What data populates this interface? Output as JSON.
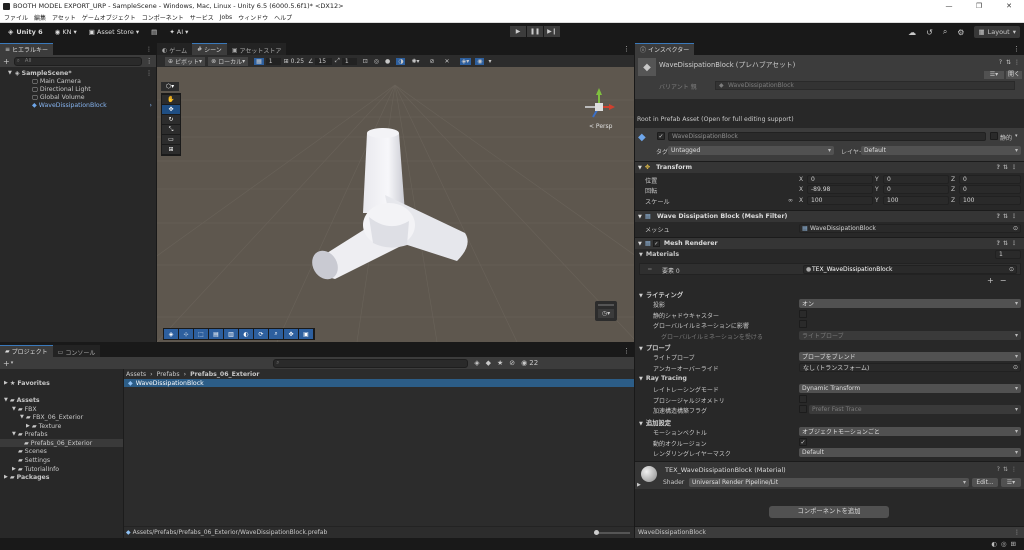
{
  "window": {
    "title": "BOOTH MODEL EXPORT_URP - SampleScene - Windows, Mac, Linux - Unity 6.5 (6000.5.6f1)* <DX12>",
    "controls": [
      "—",
      "❐",
      "✕"
    ]
  },
  "menu": [
    "ファイル",
    "編集",
    "アセット",
    "ゲームオブジェクト",
    "コンポーネント",
    "サービス",
    "Jobs",
    "ウィンドウ",
    "ヘルプ"
  ],
  "toolbar": {
    "unity": "Unity 6",
    "account": "KN",
    "asset_store": "Asset Store",
    "ai": "AI",
    "layout": "Layout"
  },
  "hierarchy": {
    "tab": "ヒエラルキー",
    "search_placeholder": "All",
    "items": [
      {
        "label": "SampleScene*",
        "indent": 0
      },
      {
        "label": "Main Camera",
        "indent": 1
      },
      {
        "label": "Directional Light",
        "indent": 1
      },
      {
        "label": "Global Volume",
        "indent": 1
      },
      {
        "label": "WaveDissipationBlock",
        "indent": 1
      }
    ]
  },
  "scene_tabs": [
    "ゲーム",
    "シーン",
    "アセットストア"
  ],
  "scene_toolbar": {
    "pivot": "ピボット",
    "local": "ローカル",
    "grid": "1",
    "snap": "0.25",
    "angle": "15",
    "scale": "1",
    "persp": "< Persp"
  },
  "project": {
    "tabs": [
      "プロジェクト",
      "コンソール"
    ],
    "count": "22",
    "breadcrumb": [
      "Assets",
      "Prefabs",
      "Prefabs_06_Exterior"
    ],
    "selected_asset": "WaveDissipationBlock",
    "tree": [
      {
        "label": "Favorites",
        "indent": 0,
        "bold": true
      },
      {
        "label": "Assets",
        "indent": 0,
        "bold": true
      },
      {
        "label": "FBX",
        "indent": 1
      },
      {
        "label": "FBX_06_Exterior",
        "indent": 2
      },
      {
        "label": "Texture",
        "indent": 3
      },
      {
        "label": "Prefabs",
        "indent": 1
      },
      {
        "label": "Prefabs_06_Exterior",
        "indent": 2
      },
      {
        "label": "Scenes",
        "indent": 1
      },
      {
        "label": "Settings",
        "indent": 1
      },
      {
        "label": "TutorialInfo",
        "indent": 1
      },
      {
        "label": "Packages",
        "indent": 0,
        "bold": true
      }
    ],
    "path": "Assets/Prefabs/Prefabs_06_Exterior/WaveDissipationBlock.prefab"
  },
  "inspector": {
    "tab": "インスペクター",
    "asset_title": "WaveDissipationBlock (プレハブアセット)",
    "open": "開く",
    "variant_label": "バリアント 親",
    "variant_value": "WaveDissipationBlock",
    "root_note": "Root in Prefab Asset (Open for full editing support)",
    "object_name": "WaveDissipationBlock",
    "static": "静的",
    "tag_label": "タグ",
    "tag": "Untagged",
    "layer_label": "レイヤー",
    "layer": "Default",
    "transform": {
      "title": "Transform",
      "position_label": "位置",
      "rotation_label": "回転",
      "scale_label": "スケール",
      "position": [
        "0",
        "0",
        "0"
      ],
      "rotation": [
        "-89.98",
        "0",
        "0"
      ],
      "scale": [
        "100",
        "100",
        "100"
      ]
    },
    "mesh_filter": {
      "title": "Wave Dissipation Block (Mesh Filter)",
      "mesh_label": "メッシュ",
      "mesh": "WaveDissipationBlock"
    },
    "mesh_renderer": {
      "title": "Mesh Renderer",
      "materials_label": "Materials",
      "materials_count": "1",
      "element_label": "要素 0",
      "element_value": "TEX_WaveDissipationBlock",
      "lighting": "ライティング",
      "cast_shadows_label": "投影",
      "cast_shadows": "オン",
      "static_shadow_caster": "静的シャドウキャスター",
      "contribute_gi": "グローバルイルミネーションに影響",
      "receive_gi_label": "グローバルイルミネーションを受ける",
      "receive_gi": "ライトプローブ",
      "probes": "プローブ",
      "light_probes_label": "ライトプローブ",
      "light_probes": "プローブをブレンド",
      "anchor_label": "アンカーオーバーライド",
      "anchor": "なし (トランスフォーム)",
      "ray_tracing": "Ray Tracing",
      "rt_mode_label": "レイトレーシングモード",
      "rt_mode": "Dynamic Transform",
      "procedural_label": "プロシージャルジオメトリ",
      "accel_label": "加速構造構築フラグ",
      "accel": "Prefer Fast Trace",
      "additional": "追加設定",
      "motion_label": "モーションベクトル",
      "motion": "オブジェクトモーションごと",
      "occlusion_label": "動的オクルージョン",
      "layer_mask_label": "レンダリングレイヤーマスク",
      "layer_mask": "Default"
    },
    "material": {
      "title": "TEX_WaveDissipationBlock (Material)",
      "shader_label": "Shader",
      "shader": "Universal Render Pipeline/Lit",
      "edit": "Edit..."
    },
    "add_component": "コンポーネントを追加",
    "footer": "WaveDissipationBlock"
  }
}
